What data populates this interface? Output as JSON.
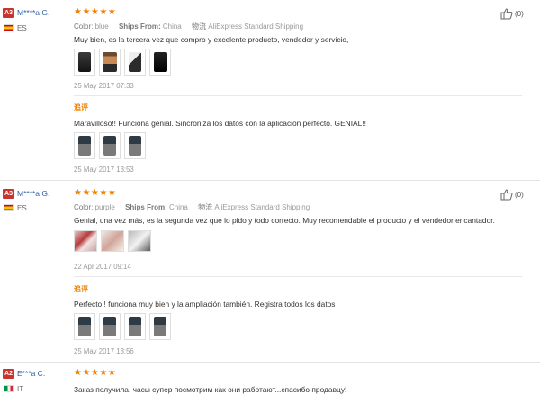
{
  "reviews": [
    {
      "level": "A3",
      "user": "M****a G.",
      "country": "ES",
      "stars": "★★★★★",
      "color_label": "Color:",
      "color_value": "blue",
      "ships_label": "Ships From:",
      "ships_value": "China",
      "shipping_label": "物流",
      "shipping_value": "AliExpress Standard Shipping",
      "text": "Muy bien, es la tercera vez que compro y excelente producto, vendedor y servicio,",
      "date": "25 May 2017 07:33",
      "helpful": "(0)",
      "followup": {
        "label": "追评",
        "text": "Maravilloso!! Funciona genial. Sincroniza los datos con la aplicación perfecto. GENIAL!!",
        "date": "25 May 2017 13:53"
      }
    },
    {
      "level": "A3",
      "user": "M****a G.",
      "country": "ES",
      "stars": "★★★★★",
      "color_label": "Color:",
      "color_value": "purple",
      "ships_label": "Ships From:",
      "ships_value": "China",
      "shipping_label": "物流",
      "shipping_value": "AliExpress Standard Shipping",
      "text": "Genial, una vez más, es la segunda vez que lo pido y todo correcto. Muy recomendable el producto y el vendedor encantador.",
      "date": "22 Apr 2017 09:14",
      "helpful": "(0)",
      "followup": {
        "label": "追评",
        "text": "Perfecto!! funciona muy bien y la ampliación también. Registra todos los datos",
        "date": "25 May 2017 13:56"
      }
    },
    {
      "level": "A2",
      "user": "E***a C.",
      "country": "IT",
      "stars": "★★★★★",
      "text": "Заказ получила, часы супер посмотрим как они работают...спасибо продавцу!"
    }
  ]
}
